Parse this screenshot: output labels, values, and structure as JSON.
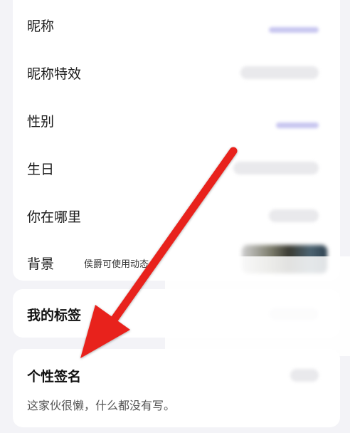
{
  "profile": {
    "rows": [
      {
        "label": "昵称"
      },
      {
        "label": "昵称特效"
      },
      {
        "label": "性别"
      },
      {
        "label": "生日"
      },
      {
        "label": "你在哪里"
      },
      {
        "label": "背景",
        "hint": "侯爵可使用动态"
      }
    ]
  },
  "tags": {
    "title": "我的标签"
  },
  "signature": {
    "title": "个性签名",
    "text": "这家伙很懒，什么都没有写。"
  },
  "colors": {
    "arrow": "#e8241c",
    "page_bg": "#f3f3f7"
  }
}
